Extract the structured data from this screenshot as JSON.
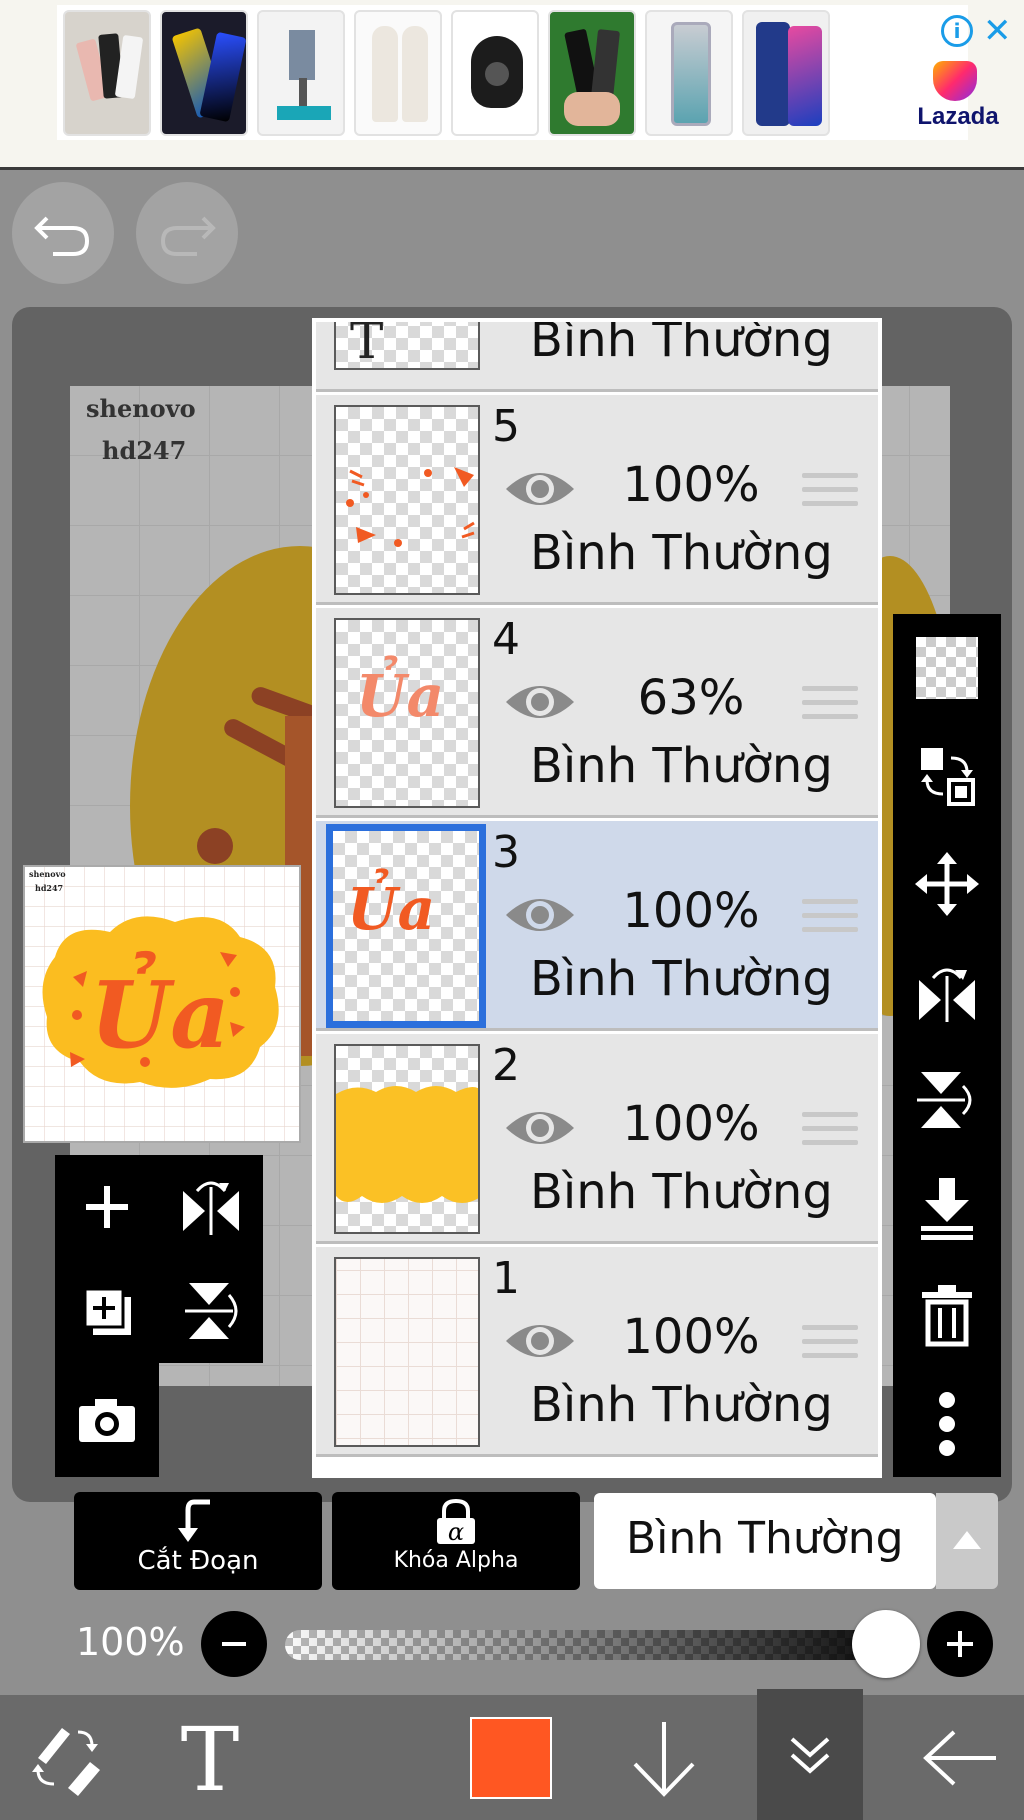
{
  "ad": {
    "brand": "Lazada",
    "thumbnails": [
      "phones-photo",
      "phone-ad",
      "drill-press",
      "gloves",
      "bluetooth-headset",
      "phones-grip",
      "phone-blue",
      "phone-samsung"
    ]
  },
  "canvas": {
    "watermark_line1": "shenovo",
    "watermark_line2": "hd247"
  },
  "preview": {
    "watermark_line1": "shenovo",
    "watermark_line2": "hd247"
  },
  "layers": {
    "top_partial": {
      "blend": "Bình Thường",
      "thumb_text": "T"
    },
    "items": [
      {
        "number": "5",
        "opacity": "100%",
        "blend": "Bình Thường",
        "selected": false
      },
      {
        "number": "4",
        "opacity": "63%",
        "blend": "Bình Thường",
        "selected": false
      },
      {
        "number": "3",
        "opacity": "100%",
        "blend": "Bình Thường",
        "selected": true
      },
      {
        "number": "2",
        "opacity": "100%",
        "blend": "Bình Thường",
        "selected": false
      },
      {
        "number": "1",
        "opacity": "100%",
        "blend": "Bình Thường",
        "selected": false
      }
    ],
    "thumb_text_4": "Ủa",
    "thumb_text_3": "Ủa"
  },
  "controls": {
    "clip_label": "Cắt Đoạn",
    "alpha_lock_label": "Khóa Alpha",
    "blend_mode": "Bình Thường",
    "opacity_label": "100%",
    "opacity_value": 1.0
  },
  "colors": {
    "current_color": "#ff5722",
    "selection_border": "#2b6fdc",
    "selected_layer_bg": "#cfd9ea"
  }
}
